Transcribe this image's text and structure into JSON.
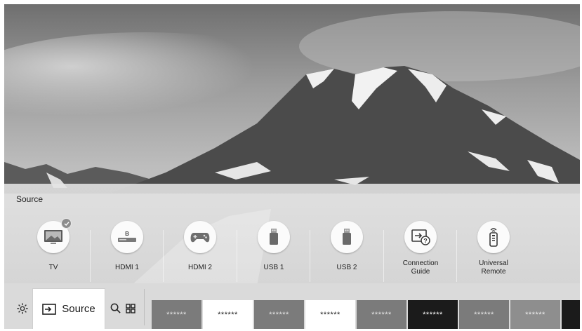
{
  "menu": {
    "title": "Source"
  },
  "sources": [
    {
      "id": "tv",
      "label": "TV",
      "icon": "tv-icon",
      "selected": true
    },
    {
      "id": "hdmi1",
      "label": "HDMI 1",
      "icon": "bluray-player-icon"
    },
    {
      "id": "hdmi2",
      "label": "HDMI 2",
      "icon": "game-controller-icon"
    },
    {
      "id": "usb1",
      "label": "USB 1",
      "icon": "usb-drive-icon"
    },
    {
      "id": "usb2",
      "label": "USB 2",
      "icon": "usb-drive-icon"
    },
    {
      "id": "guide",
      "label": "Connection\nGuide",
      "icon": "connection-guide-icon"
    },
    {
      "id": "remote",
      "label": "Universal\nRemote",
      "icon": "remote-control-icon"
    }
  ],
  "bottom_bar": {
    "settings_icon": "gear-icon",
    "source_label": "Source",
    "source_icon": "source-input-icon",
    "search_icon": "search-icon",
    "apps_icon": "apps-grid-icon",
    "tiles": [
      {
        "label": "******",
        "style": "dark"
      },
      {
        "label": "******",
        "style": "light"
      },
      {
        "label": "******",
        "style": "dark"
      },
      {
        "label": "******",
        "style": "light"
      },
      {
        "label": "******",
        "style": "dark"
      },
      {
        "label": "******",
        "style": "black"
      },
      {
        "label": "******",
        "style": "dark"
      },
      {
        "label": "******",
        "style": "mid"
      },
      {
        "label": "**",
        "style": "black"
      }
    ]
  },
  "colors": {
    "tile_dark": "#7b7b7b",
    "tile_light": "#ffffff",
    "tile_black": "#1b1b1b",
    "tile_mid": "#8e8e8e"
  }
}
